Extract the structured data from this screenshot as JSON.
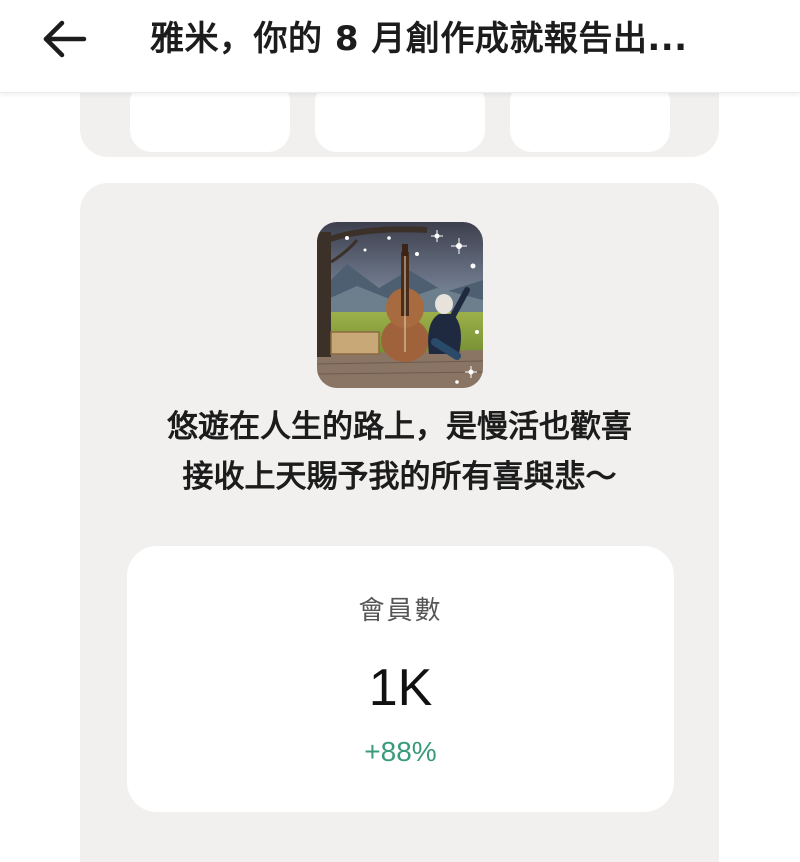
{
  "header": {
    "title": "雅米，你的 8 月創作成就報告出..."
  },
  "profile": {
    "bio_line1": "悠遊在人生的路上，是慢活也歡喜",
    "bio_line2": "接收上天賜予我的所有喜與悲～"
  },
  "stat": {
    "label": "會員數",
    "value": "1K",
    "delta": "+88%",
    "delta_color": "#3a9b7a"
  },
  "icons": {
    "back": "arrow-left-icon"
  }
}
